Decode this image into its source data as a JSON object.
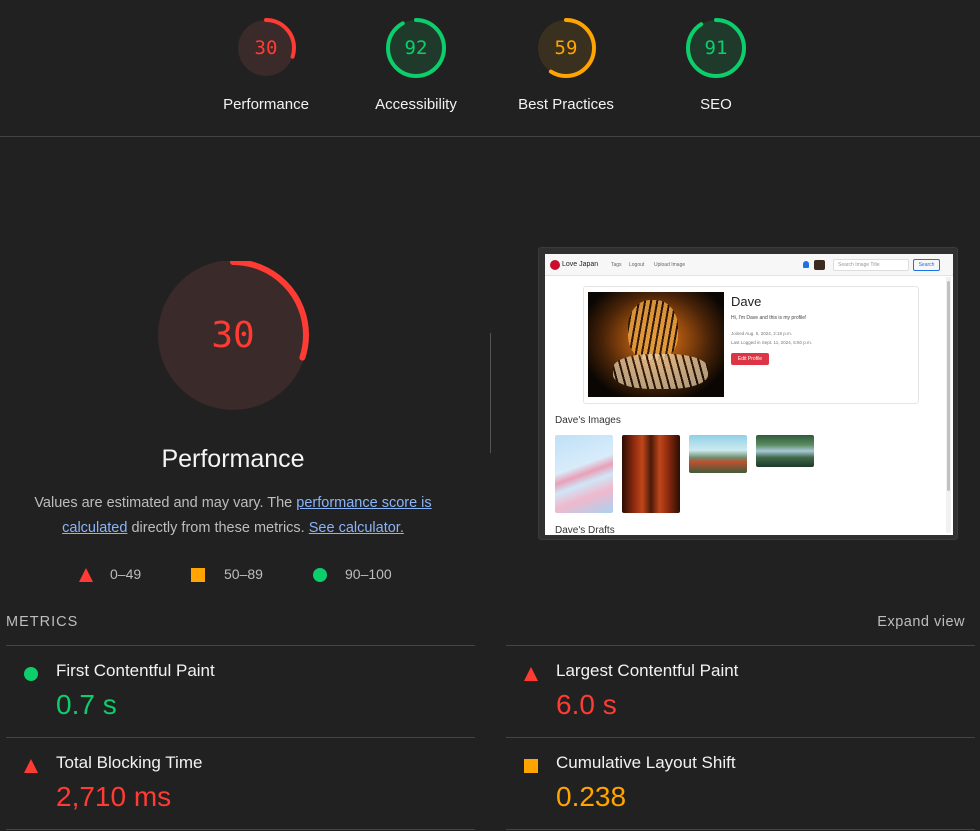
{
  "summary": {
    "gauges": [
      {
        "label": "Performance",
        "score": "30",
        "value": 30,
        "color": "#ff3b33",
        "bg": "#3a2a2a"
      },
      {
        "label": "Accessibility",
        "score": "92",
        "value": 92,
        "color": "#0cce6b",
        "bg": "#1f3a2a"
      },
      {
        "label": "Best Practices",
        "score": "59",
        "value": 59,
        "color": "#ffa400",
        "bg": "#3a3020"
      },
      {
        "label": "SEO",
        "score": "91",
        "value": 91,
        "color": "#0cce6b",
        "bg": "#1f3a2a"
      }
    ]
  },
  "performance": {
    "score": "30",
    "value": 30,
    "title": "Performance",
    "desc_prefix": "Values are estimated and may vary. The ",
    "desc_link1": "performance score is calculated",
    "desc_middle": " directly from these metrics. ",
    "desc_link2": "See calculator."
  },
  "legend": {
    "fail": "0–49",
    "average": "50–89",
    "pass": "90–100"
  },
  "screenshot": {
    "brand": "Love Japan",
    "nav_links": [
      "Tags",
      "Logout",
      "Upload Image"
    ],
    "search_placeholder": "Search Image Title",
    "search_button": "Search",
    "profile_name": "Dave",
    "bio": "Hi, I'm Dave and this is my profile!",
    "joined": "Joined Aug. 5, 2024, 2:18 p.m.",
    "last_logged": "Last Logged in Sept. 11, 2024, 5:50 p.m.",
    "edit_button": "Edit Profile",
    "images_heading": "Dave's Images",
    "drafts_heading": "Dave's Drafts"
  },
  "metrics": {
    "heading": "METRICS",
    "expand": "Expand view",
    "items": [
      {
        "title": "First Contentful Paint",
        "value": "0.7 s",
        "status": "pass"
      },
      {
        "title": "Largest Contentful Paint",
        "value": "6.0 s",
        "status": "fail"
      },
      {
        "title": "Total Blocking Time",
        "value": "2,710 ms",
        "status": "fail"
      },
      {
        "title": "Cumulative Layout Shift",
        "value": "0.238",
        "status": "average"
      }
    ]
  }
}
